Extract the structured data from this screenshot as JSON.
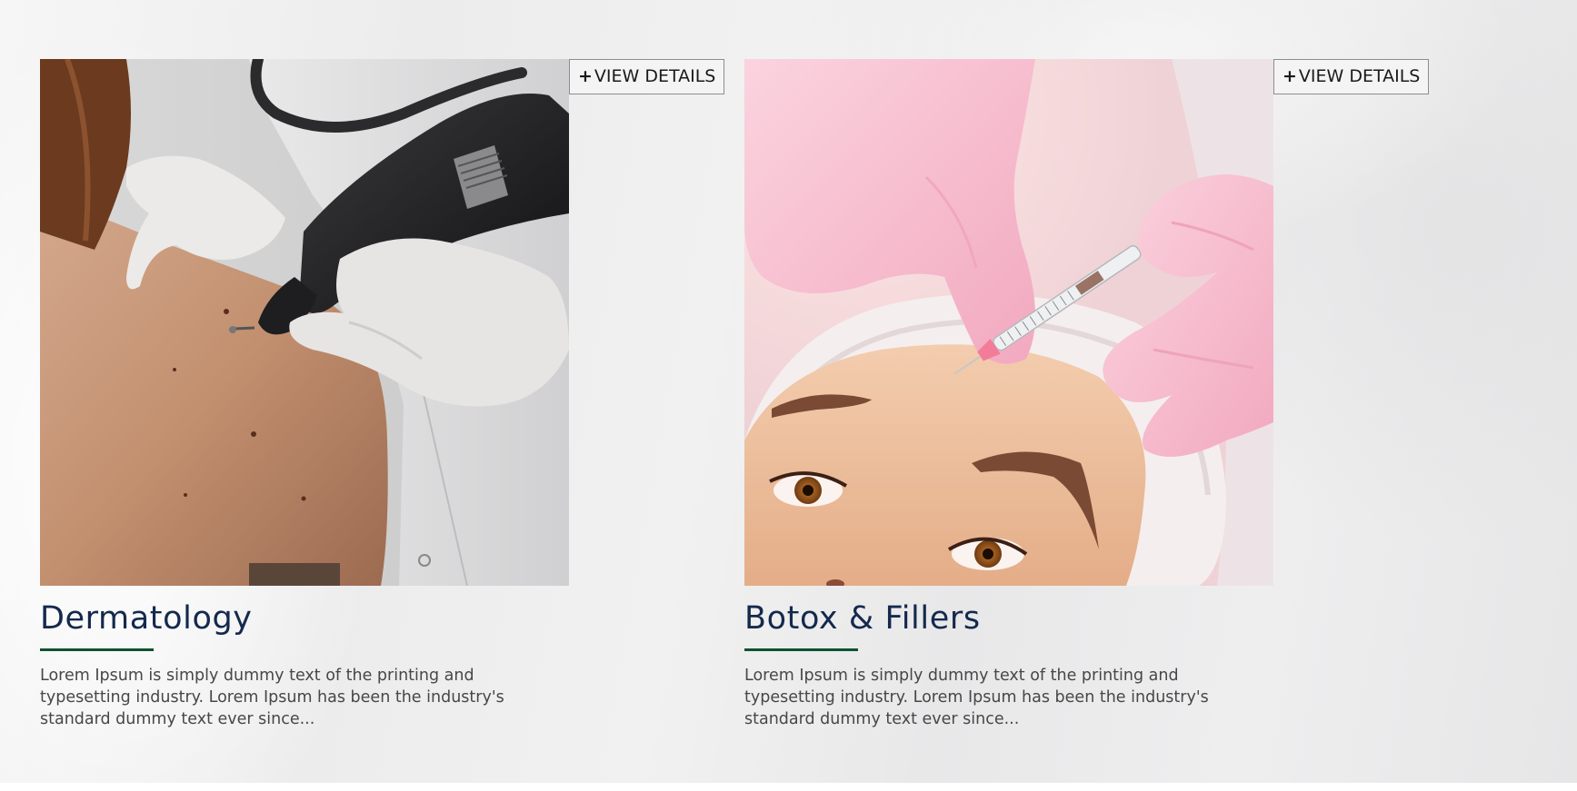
{
  "cards": [
    {
      "title": "Dermatology",
      "button_plus": "+",
      "button_label": "VIEW DETAILS",
      "description": "Lorem Ipsum is simply dummy text of the printing and typesetting industry. Lorem Ipsum has been the industry's standard dummy text ever since...",
      "image_subject": "dermatologist examining moles on patient's back with a device"
    },
    {
      "title": "Botox & Fillers",
      "button_plus": "+",
      "button_label": "VIEW DETAILS",
      "description": "Lorem Ipsum is simply dummy text of the printing and typesetting industry. Lorem Ipsum has been the industry's standard dummy text ever since...",
      "image_subject": "woman receiving forehead injection from gloved hands"
    }
  ],
  "colors": {
    "title": "#14294d",
    "underline_accent": "#0f5230",
    "body_text": "#474747",
    "button_border": "#8d8d8d"
  }
}
